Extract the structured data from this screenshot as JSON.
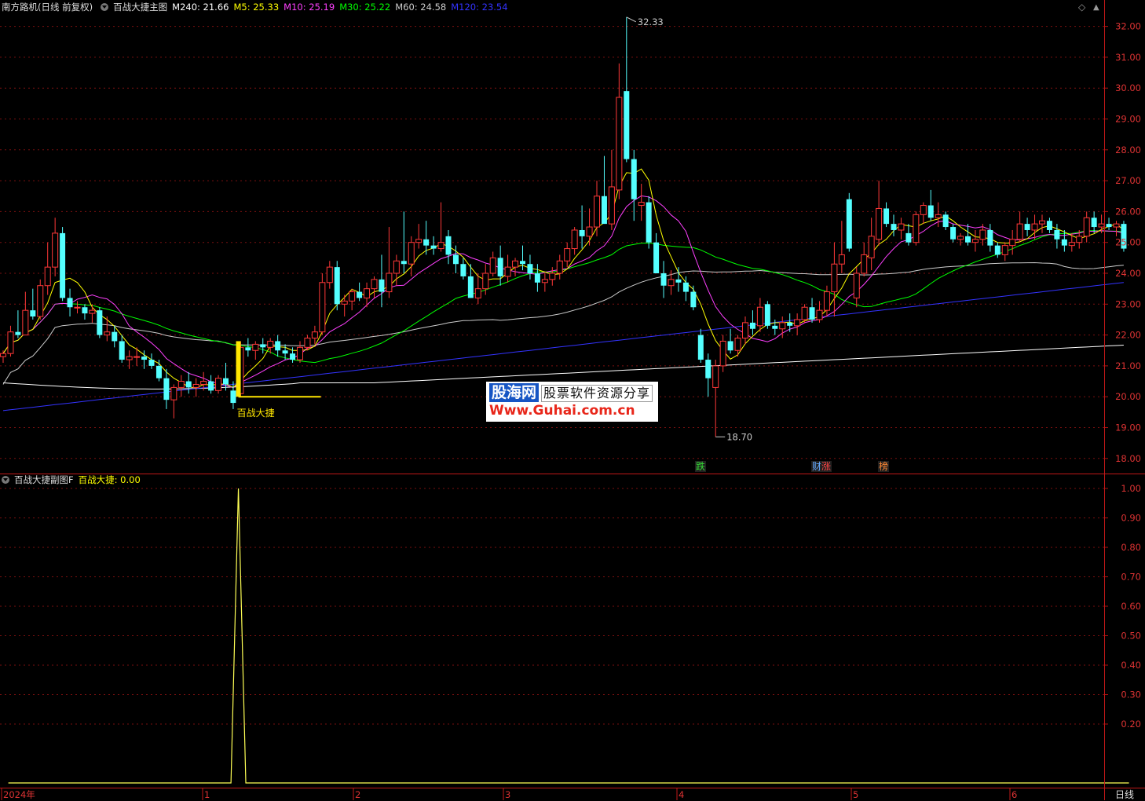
{
  "header": {
    "stock_title": "南方路机(日线 前复权)",
    "indicator_name": "百战大捷主图",
    "ma_values": [
      {
        "label": "M240: 21.66",
        "color": "#ffffff"
      },
      {
        "label": "M5: 25.33",
        "color": "#ffff00"
      },
      {
        "label": "M10: 25.19",
        "color": "#ff40ff"
      },
      {
        "label": "M30: 25.22",
        "color": "#00ff00"
      },
      {
        "label": "M60: 24.58",
        "color": "#cccccc"
      },
      {
        "label": "M120: 23.54",
        "color": "#3333ff"
      }
    ]
  },
  "sub_header": {
    "indicator_name": "百战大捷副图F",
    "value_label": "百战大捷: 0.00",
    "value_color": "#ffff00"
  },
  "controls": {
    "diamond": "◇",
    "up_icon": "▲"
  },
  "watermark": {
    "logo": "股海网",
    "slogan": "股票软件资源分享",
    "url": "Www.Guhai.com.cn"
  },
  "period_label": "日线",
  "chart_data": {
    "type": "candlestick",
    "main_y_ticks": [
      "32.00",
      "31.00",
      "30.00",
      "29.00",
      "28.00",
      "27.00",
      "26.00",
      "25.00",
      "24.00",
      "23.00",
      "22.00",
      "21.00",
      "20.00",
      "19.00",
      "18.00"
    ],
    "sub_y_ticks": [
      "1.00",
      "0.90",
      "0.80",
      "0.70",
      "0.60",
      "0.50",
      "0.40",
      "0.30",
      "0.20"
    ],
    "x_labels": [
      "2024年",
      "1",
      "2",
      "3",
      "4",
      "5",
      "6"
    ],
    "high_marker": "32.33",
    "low_marker": "18.70",
    "signal_text": "百战大捷",
    "event_labels": [
      {
        "text": "跌",
        "color": "#33dd33"
      },
      {
        "text": "财",
        "color": "#66aaff"
      },
      {
        "text": "涨",
        "color": "#ff4444"
      },
      {
        "text": "榜",
        "color": "#ff8833"
      }
    ],
    "signal_index": 31,
    "sub_series": {
      "name": "百战大捷",
      "peak_index": 31,
      "peak_value": 1.0,
      "other_value": 0.0
    },
    "candles": [
      [
        21.3,
        21.5,
        21.1,
        21.4
      ],
      [
        21.4,
        22.3,
        21.3,
        22.1
      ],
      [
        22.1,
        22.8,
        21.9,
        22.0
      ],
      [
        22.0,
        23.4,
        22.0,
        22.8
      ],
      [
        22.8,
        23.5,
        22.5,
        22.6
      ],
      [
        22.6,
        23.8,
        22.5,
        23.6
      ],
      [
        23.6,
        25.0,
        23.3,
        24.2
      ],
      [
        24.2,
        25.8,
        23.9,
        25.3
      ],
      [
        25.3,
        25.5,
        23.1,
        23.2
      ],
      [
        23.2,
        23.5,
        22.6,
        22.9
      ],
      [
        22.9,
        23.1,
        22.7,
        22.9
      ],
      [
        22.9,
        23.0,
        22.5,
        22.7
      ],
      [
        22.7,
        23.0,
        22.4,
        22.8
      ],
      [
        22.8,
        22.9,
        21.9,
        22.0
      ],
      [
        22.0,
        22.6,
        21.8,
        22.1
      ],
      [
        22.1,
        22.3,
        21.6,
        21.8
      ],
      [
        21.8,
        22.0,
        21.1,
        21.2
      ],
      [
        21.2,
        21.5,
        20.9,
        21.3
      ],
      [
        21.3,
        21.6,
        21.0,
        21.3
      ],
      [
        21.3,
        21.5,
        20.9,
        21.2
      ],
      [
        21.2,
        21.4,
        20.9,
        21.0
      ],
      [
        21.0,
        21.2,
        20.5,
        20.6
      ],
      [
        20.6,
        20.9,
        19.6,
        19.9
      ],
      [
        19.9,
        20.4,
        19.3,
        20.3
      ],
      [
        20.3,
        20.7,
        20.0,
        20.5
      ],
      [
        20.5,
        20.8,
        20.1,
        20.3
      ],
      [
        20.3,
        20.6,
        20.0,
        20.4
      ],
      [
        20.4,
        20.8,
        20.2,
        20.5
      ],
      [
        20.5,
        20.7,
        20.1,
        20.2
      ],
      [
        20.2,
        20.7,
        20.1,
        20.6
      ],
      [
        20.6,
        21.1,
        20.2,
        20.4
      ],
      [
        20.2,
        20.5,
        19.6,
        19.8
      ],
      [
        20.1,
        21.8,
        20.0,
        21.6
      ],
      [
        21.6,
        21.9,
        21.3,
        21.5
      ],
      [
        21.5,
        21.8,
        21.2,
        21.7
      ],
      [
        21.7,
        21.9,
        21.4,
        21.6
      ],
      [
        21.6,
        21.9,
        21.4,
        21.8
      ],
      [
        21.8,
        22.0,
        21.3,
        21.5
      ],
      [
        21.5,
        21.7,
        21.2,
        21.4
      ],
      [
        21.4,
        21.6,
        21.1,
        21.2
      ],
      [
        21.2,
        21.8,
        21.1,
        21.6
      ],
      [
        21.6,
        22.0,
        21.5,
        21.9
      ],
      [
        21.9,
        22.3,
        21.7,
        22.1
      ],
      [
        22.1,
        24.0,
        22.0,
        23.7
      ],
      [
        23.7,
        24.4,
        23.5,
        24.2
      ],
      [
        24.2,
        24.4,
        22.8,
        23.0
      ],
      [
        23.0,
        23.3,
        22.6,
        23.1
      ],
      [
        23.1,
        23.5,
        22.8,
        23.4
      ],
      [
        23.4,
        23.7,
        23.1,
        23.2
      ],
      [
        23.2,
        23.7,
        22.9,
        23.5
      ],
      [
        23.5,
        23.9,
        23.2,
        23.8
      ],
      [
        23.8,
        24.6,
        22.9,
        23.4
      ],
      [
        23.4,
        25.5,
        23.2,
        24.0
      ],
      [
        24.0,
        24.6,
        23.6,
        24.4
      ],
      [
        24.4,
        26.0,
        24.0,
        24.3
      ],
      [
        24.3,
        25.2,
        23.9,
        25.0
      ],
      [
        25.0,
        25.6,
        24.8,
        25.1
      ],
      [
        25.1,
        25.7,
        24.6,
        24.9
      ],
      [
        24.9,
        25.2,
        24.6,
        24.8
      ],
      [
        24.8,
        26.3,
        24.7,
        25.0
      ],
      [
        25.2,
        25.4,
        24.3,
        24.6
      ],
      [
        24.6,
        24.9,
        24.0,
        24.3
      ],
      [
        24.3,
        24.5,
        23.8,
        23.9
      ],
      [
        23.9,
        24.3,
        23.2,
        23.2
      ],
      [
        23.2,
        24.0,
        23.0,
        23.5
      ],
      [
        23.5,
        24.3,
        23.3,
        24.0
      ],
      [
        24.0,
        24.7,
        23.9,
        24.5
      ],
      [
        24.5,
        24.9,
        23.6,
        23.9
      ],
      [
        23.9,
        24.6,
        23.7,
        24.2
      ],
      [
        24.2,
        24.5,
        23.9,
        24.4
      ],
      [
        24.4,
        24.9,
        24.1,
        24.3
      ],
      [
        24.3,
        24.6,
        23.8,
        24.0
      ],
      [
        24.0,
        24.3,
        23.4,
        23.7
      ],
      [
        23.7,
        24.0,
        23.4,
        23.8
      ],
      [
        23.8,
        24.2,
        23.6,
        24.0
      ],
      [
        24.0,
        24.6,
        23.8,
        24.4
      ],
      [
        24.4,
        25.0,
        24.2,
        24.8
      ],
      [
        24.8,
        25.5,
        24.6,
        25.4
      ],
      [
        25.4,
        26.2,
        24.8,
        25.2
      ],
      [
        25.2,
        26.1,
        24.9,
        25.5
      ],
      [
        25.5,
        27.0,
        25.2,
        26.5
      ],
      [
        26.5,
        27.8,
        25.8,
        25.6
      ],
      [
        25.6,
        28.0,
        25.4,
        26.8
      ],
      [
        26.7,
        30.8,
        26.4,
        29.7
      ],
      [
        29.9,
        32.3,
        27.6,
        27.7
      ],
      [
        27.7,
        28.0,
        25.7,
        26.4
      ],
      [
        26.2,
        26.9,
        25.7,
        26.3
      ],
      [
        26.3,
        26.5,
        24.8,
        25.0
      ],
      [
        25.0,
        25.3,
        24.0,
        24.0
      ],
      [
        24.0,
        24.4,
        23.2,
        23.6
      ],
      [
        23.6,
        24.1,
        23.3,
        23.8
      ],
      [
        23.8,
        24.2,
        23.4,
        23.7
      ],
      [
        23.7,
        23.9,
        23.1,
        23.4
      ],
      [
        23.4,
        23.6,
        22.8,
        22.9
      ],
      [
        22.0,
        22.2,
        21.1,
        21.2
      ],
      [
        21.2,
        21.4,
        20.0,
        20.6
      ],
      [
        20.3,
        21.2,
        18.7,
        21.0
      ],
      [
        21.0,
        22.0,
        20.8,
        21.8
      ],
      [
        21.8,
        22.2,
        21.4,
        21.5
      ],
      [
        21.5,
        22.0,
        21.3,
        21.9
      ],
      [
        21.9,
        22.6,
        21.7,
        22.4
      ],
      [
        22.4,
        22.8,
        22.0,
        22.2
      ],
      [
        22.3,
        23.2,
        22.1,
        22.9
      ],
      [
        23.0,
        23.1,
        22.2,
        22.3
      ],
      [
        22.3,
        22.5,
        22.0,
        22.2
      ],
      [
        22.2,
        22.6,
        21.9,
        22.4
      ],
      [
        22.4,
        22.7,
        22.1,
        22.3
      ],
      [
        22.3,
        22.7,
        22.0,
        22.5
      ],
      [
        22.5,
        23.0,
        22.4,
        22.9
      ],
      [
        22.9,
        23.2,
        22.4,
        22.5
      ],
      [
        22.5,
        23.1,
        22.4,
        22.8
      ],
      [
        22.8,
        23.6,
        22.6,
        23.4
      ],
      [
        23.4,
        25.0,
        22.6,
        24.3
      ],
      [
        24.3,
        25.7,
        24.0,
        24.6
      ],
      [
        26.4,
        26.6,
        24.7,
        24.8
      ],
      [
        23.2,
        24.2,
        22.9,
        24.0
      ],
      [
        24.0,
        25.0,
        23.9,
        24.6
      ],
      [
        24.5,
        25.8,
        24.1,
        25.2
      ],
      [
        25.1,
        27.0,
        24.9,
        26.1
      ],
      [
        26.1,
        26.3,
        25.5,
        25.6
      ],
      [
        25.6,
        25.9,
        25.2,
        25.4
      ],
      [
        25.4,
        25.8,
        25.1,
        25.6
      ],
      [
        25.3,
        25.6,
        24.9,
        25.0
      ],
      [
        25.0,
        26.0,
        24.9,
        25.9
      ],
      [
        25.9,
        26.3,
        25.6,
        26.2
      ],
      [
        26.2,
        26.7,
        25.7,
        25.8
      ],
      [
        25.8,
        26.3,
        25.5,
        25.9
      ],
      [
        25.9,
        26.0,
        25.4,
        25.5
      ],
      [
        25.5,
        25.6,
        25.0,
        25.1
      ],
      [
        25.1,
        25.3,
        24.9,
        25.2
      ],
      [
        25.2,
        25.6,
        24.9,
        25.0
      ],
      [
        25.0,
        25.4,
        24.7,
        25.1
      ],
      [
        25.1,
        25.6,
        24.9,
        25.4
      ],
      [
        25.4,
        25.6,
        24.7,
        24.9
      ],
      [
        24.9,
        25.0,
        24.5,
        24.6
      ],
      [
        24.6,
        25.0,
        24.4,
        24.9
      ],
      [
        24.9,
        25.4,
        24.6,
        25.1
      ],
      [
        25.1,
        26.0,
        25.0,
        25.6
      ],
      [
        25.6,
        25.8,
        25.2,
        25.4
      ],
      [
        25.4,
        25.9,
        25.1,
        25.6
      ],
      [
        25.6,
        25.9,
        25.3,
        25.7
      ],
      [
        25.7,
        25.8,
        25.3,
        25.4
      ],
      [
        25.4,
        25.6,
        24.8,
        25.1
      ],
      [
        25.1,
        25.4,
        24.7,
        24.9
      ],
      [
        24.9,
        25.3,
        24.7,
        25.0
      ],
      [
        25.0,
        25.4,
        24.8,
        25.2
      ],
      [
        25.2,
        26.0,
        25.0,
        25.8
      ],
      [
        25.8,
        26.0,
        25.3,
        25.5
      ],
      [
        25.5,
        25.9,
        25.3,
        25.6
      ],
      [
        25.6,
        25.8,
        25.4,
        25.5
      ],
      [
        25.5,
        25.7,
        25.2,
        25.6
      ],
      [
        25.6,
        25.7,
        24.7,
        24.8
      ]
    ]
  }
}
